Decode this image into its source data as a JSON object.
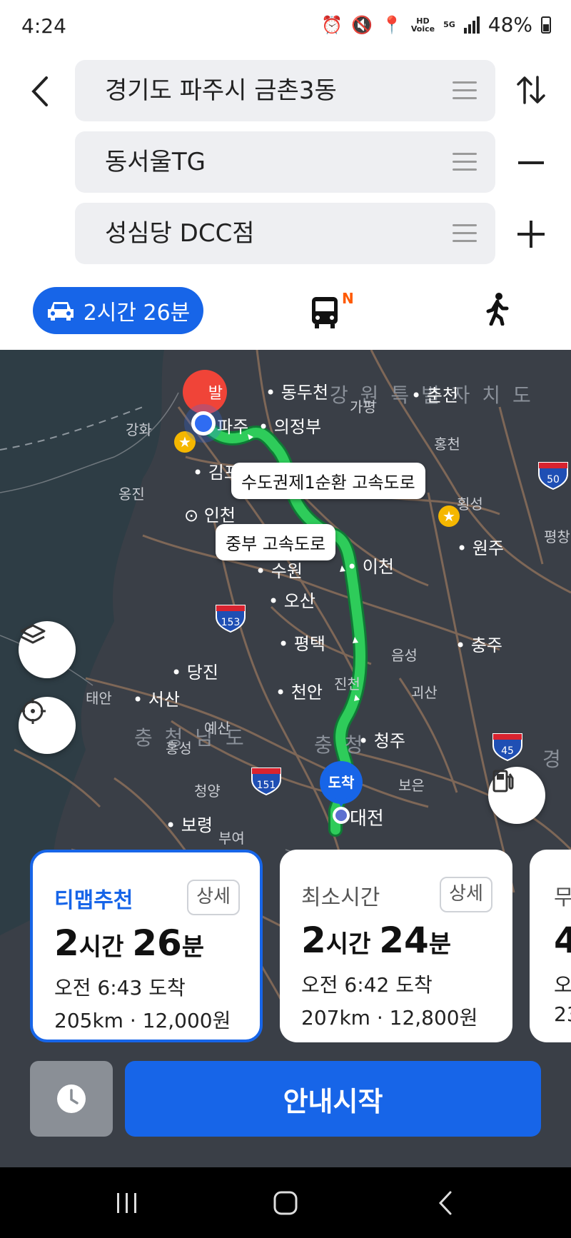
{
  "status_bar": {
    "time": "4:24",
    "battery": "48%",
    "hd_label": "HD",
    "voice_label": "Voice",
    "net_label": "5G"
  },
  "route": {
    "origin": "경기도 파주시 금촌3동",
    "waypoint": "동서울TG",
    "destination": "성심당 DCC점"
  },
  "modes": {
    "car_time": "2시간 26분",
    "bus_badge": "N"
  },
  "map": {
    "cities": [
      "동두천",
      "춘천",
      "가평",
      "강화",
      "파주",
      "의정부",
      "홍천",
      "김포",
      "옹진",
      "인천",
      "횡성",
      "원주",
      "평창",
      "수원",
      "이천",
      "오산",
      "평택",
      "음성",
      "충주",
      "당진",
      "진천",
      "태안",
      "서산",
      "천안",
      "괴산",
      "예산",
      "홍성",
      "청주",
      "청양",
      "보은",
      "보령",
      "부여",
      "대전"
    ],
    "regions": [
      "강 원 특 별 자 치 도",
      "충 청 남 도",
      "충 청",
      "경 상"
    ],
    "road_labels": [
      "수도권제1순환 고속도로",
      "중부 고속도로"
    ],
    "shields": [
      "50",
      "153",
      "151",
      "45"
    ],
    "start_pin": "발",
    "arrive_pin": "도착"
  },
  "cards": [
    {
      "label": "티맵추천",
      "detail": "상세",
      "hours": "2",
      "hour_unit": "시간",
      "minutes": "26",
      "min_unit": "분",
      "eta": "오전 6:43 도착",
      "distance": "205km",
      "toll": "12,000원"
    },
    {
      "label": "최소시간",
      "detail": "상세",
      "hours": "2",
      "hour_unit": "시간",
      "minutes": "24",
      "min_unit": "분",
      "eta": "오전 6:42 도착",
      "distance": "207km",
      "toll": "12,800원"
    },
    {
      "label": "무",
      "hours": "4",
      "eta": "오",
      "distance": "23"
    }
  ],
  "actions": {
    "start": "안내시작"
  },
  "colors": {
    "accent": "#1765e8",
    "route": "#22c55e",
    "map_bg": "#3a3f47"
  }
}
